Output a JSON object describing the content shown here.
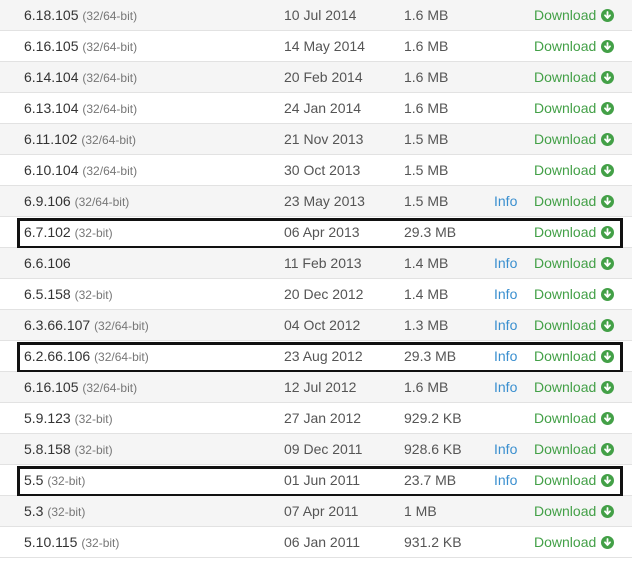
{
  "rows": [
    {
      "version": "6.18.105",
      "bits": "(32/64-bit)",
      "date": "10 Jul 2014",
      "size": "1.6 MB",
      "info": "",
      "download": "Download",
      "highlighted": false
    },
    {
      "version": "6.16.105",
      "bits": "(32/64-bit)",
      "date": "14 May 2014",
      "size": "1.6 MB",
      "info": "",
      "download": "Download",
      "highlighted": false
    },
    {
      "version": "6.14.104",
      "bits": "(32/64-bit)",
      "date": "20 Feb 2014",
      "size": "1.6 MB",
      "info": "",
      "download": "Download",
      "highlighted": false
    },
    {
      "version": "6.13.104",
      "bits": "(32/64-bit)",
      "date": "24 Jan 2014",
      "size": "1.6 MB",
      "info": "",
      "download": "Download",
      "highlighted": false
    },
    {
      "version": "6.11.102",
      "bits": "(32/64-bit)",
      "date": "21 Nov 2013",
      "size": "1.5 MB",
      "info": "",
      "download": "Download",
      "highlighted": false
    },
    {
      "version": "6.10.104",
      "bits": "(32/64-bit)",
      "date": "30 Oct 2013",
      "size": "1.5 MB",
      "info": "",
      "download": "Download",
      "highlighted": false
    },
    {
      "version": "6.9.106",
      "bits": "(32/64-bit)",
      "date": "23 May 2013",
      "size": "1.5 MB",
      "info": "Info",
      "download": "Download",
      "highlighted": false
    },
    {
      "version": "6.7.102",
      "bits": "(32-bit)",
      "date": "06 Apr 2013",
      "size": "29.3 MB",
      "info": "",
      "download": "Download",
      "highlighted": true
    },
    {
      "version": "6.6.106",
      "bits": "",
      "date": "11 Feb 2013",
      "size": "1.4 MB",
      "info": "Info",
      "download": "Download",
      "highlighted": false
    },
    {
      "version": "6.5.158",
      "bits": "(32-bit)",
      "date": "20 Dec 2012",
      "size": "1.4 MB",
      "info": "Info",
      "download": "Download",
      "highlighted": false
    },
    {
      "version": "6.3.66.107",
      "bits": "(32/64-bit)",
      "date": "04 Oct 2012",
      "size": "1.3 MB",
      "info": "Info",
      "download": "Download",
      "highlighted": false
    },
    {
      "version": "6.2.66.106",
      "bits": "(32/64-bit)",
      "date": "23 Aug 2012",
      "size": "29.3 MB",
      "info": "Info",
      "download": "Download",
      "highlighted": true
    },
    {
      "version": "6.16.105",
      "bits": "(32/64-bit)",
      "date": "12 Jul 2012",
      "size": "1.6 MB",
      "info": "Info",
      "download": "Download",
      "highlighted": false
    },
    {
      "version": "5.9.123",
      "bits": "(32-bit)",
      "date": "27 Jan 2012",
      "size": "929.2 KB",
      "info": "",
      "download": "Download",
      "highlighted": false
    },
    {
      "version": "5.8.158",
      "bits": "(32-bit)",
      "date": "09 Dec 2011",
      "size": "928.6 KB",
      "info": "Info",
      "download": "Download",
      "highlighted": false
    },
    {
      "version": "5.5",
      "bits": "(32-bit)",
      "date": "01 Jun 2011",
      "size": "23.7 MB",
      "info": "Info",
      "download": "Download",
      "highlighted": true
    },
    {
      "version": "5.3",
      "bits": "(32-bit)",
      "date": "07 Apr 2011",
      "size": "1 MB",
      "info": "",
      "download": "Download",
      "highlighted": false
    },
    {
      "version": "5.10.115",
      "bits": "(32-bit)",
      "date": "06 Jan 2011",
      "size": "931.2 KB",
      "info": "",
      "download": "Download",
      "highlighted": false
    }
  ],
  "icons": {
    "download": "download-arrow-circle-icon"
  },
  "colors": {
    "download": "#43a047",
    "info": "#3a8fcf",
    "highlight_border": "#111111"
  }
}
